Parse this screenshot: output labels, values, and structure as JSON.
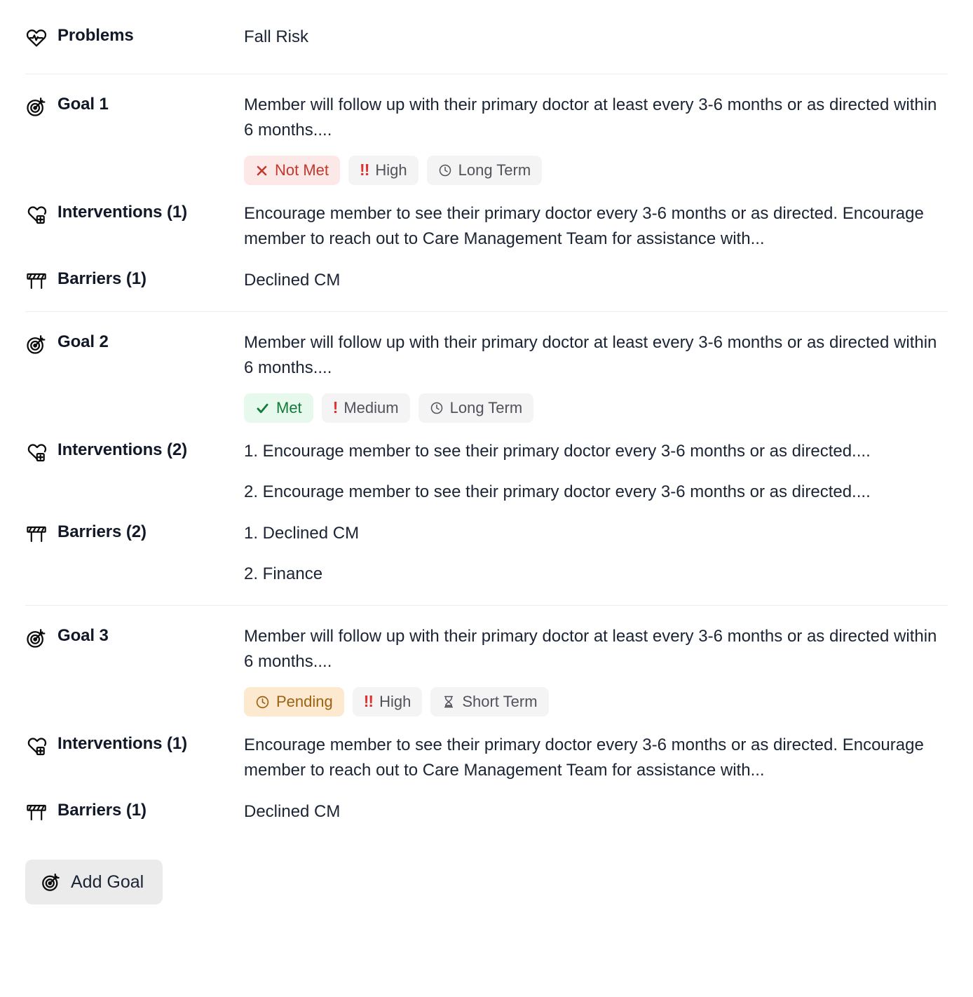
{
  "section": {
    "problems": {
      "icon": "heart-pulse-icon",
      "label": "Problems",
      "value": "Fall Risk"
    },
    "interventions_icon": "heart-plus-icon",
    "barriers_icon": "barricade-icon",
    "goal_icon": "target-goal-icon"
  },
  "colors": {
    "text": "#1b2434",
    "label": "#111827",
    "divider": "#ebedf0",
    "badge_neutral_bg": "#f4f4f5",
    "badge_neutral_text": "#52525b",
    "status_not_met_bg": "#fde8e8",
    "status_not_met_text": "#c0392b",
    "status_met_bg": "#e6f9ec",
    "status_met_text": "#117a38",
    "status_pending_bg": "#fce9cf",
    "status_pending_text": "#9a6212",
    "priority_mark": "#e03131",
    "button_bg": "#ebebeb"
  },
  "goals": [
    {
      "label": "Goal 1",
      "text": "Member will follow up with their primary doctor at least every 3-6 months or as directed within 6 months....",
      "badges": {
        "status": {
          "label": "Not Met",
          "icon": "x-icon",
          "variant": "status-notmet"
        },
        "priority": {
          "label": "High",
          "icon": "double-exclamation-icon",
          "mark": "!!"
        },
        "term": {
          "label": "Long Term",
          "icon": "clock-icon"
        }
      },
      "interventions_label": "Interventions (1)",
      "interventions": [
        "Encourage member to see their primary doctor every 3-6 months or as directed. Encourage member to reach out to Care Management Team for assistance with..."
      ],
      "barriers_label": "Barriers (1)",
      "barriers": [
        "Declined CM"
      ]
    },
    {
      "label": "Goal 2",
      "text": "Member will follow up with their primary doctor at least every 3-6 months or as directed within 6 months....",
      "badges": {
        "status": {
          "label": "Met",
          "icon": "check-icon",
          "variant": "status-met"
        },
        "priority": {
          "label": "Medium",
          "icon": "exclamation-icon",
          "mark": "!"
        },
        "term": {
          "label": "Long Term",
          "icon": "clock-icon"
        }
      },
      "interventions_label": "Interventions (2)",
      "interventions": [
        "1. Encourage member to see their primary doctor every 3-6 months or as directed....",
        "2. Encourage member to see their primary doctor every 3-6 months or as directed...."
      ],
      "barriers_label": "Barriers (2)",
      "barriers": [
        "1. Declined CM",
        "2. Finance"
      ]
    },
    {
      "label": "Goal 3",
      "text": "Member will follow up with their primary doctor at least every 3-6 months or as directed within 6 months....",
      "badges": {
        "status": {
          "label": "Pending",
          "icon": "clock-icon",
          "variant": "status-pending"
        },
        "priority": {
          "label": "High",
          "icon": "double-exclamation-icon",
          "mark": "!!"
        },
        "term": {
          "label": "Short Term",
          "icon": "hourglass-icon"
        }
      },
      "interventions_label": "Interventions (1)",
      "interventions": [
        "Encourage member to see their primary doctor every 3-6 months or as directed. Encourage member to reach out to Care Management Team for assistance with..."
      ],
      "barriers_label": "Barriers (1)",
      "barriers": [
        "Declined CM"
      ]
    }
  ],
  "footer": {
    "add_goal_label": "Add Goal",
    "add_goal_icon": "target-goal-icon"
  }
}
